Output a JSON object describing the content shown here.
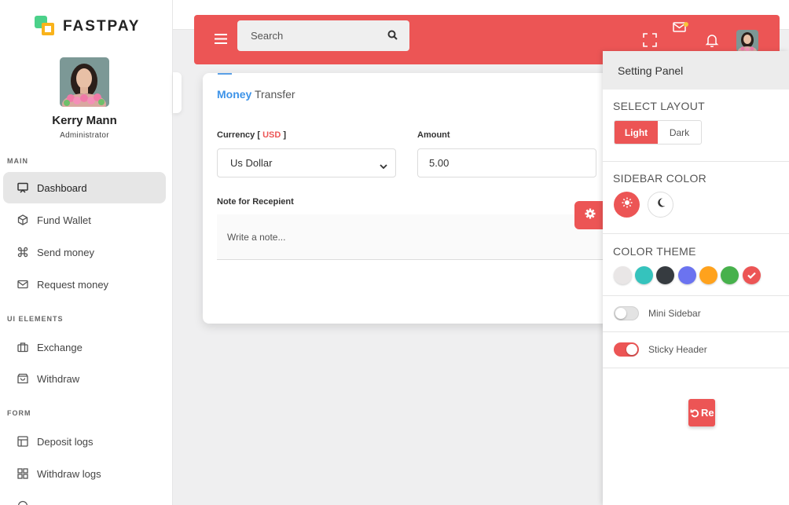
{
  "brand": {
    "name": "FASTPAY"
  },
  "user": {
    "name": "Kerry Mann",
    "role": "Administrator"
  },
  "sidebar": {
    "sections": [
      {
        "title": "MAIN",
        "items": [
          {
            "label": "Dashboard",
            "icon": "monitor-icon",
            "active": true
          },
          {
            "label": "Fund Wallet",
            "icon": "box-icon"
          },
          {
            "label": "Send money",
            "icon": "command-icon"
          },
          {
            "label": "Request money",
            "icon": "mail-icon"
          }
        ]
      },
      {
        "title": "UI ELEMENTS",
        "items": [
          {
            "label": "Exchange",
            "icon": "briefcase-icon"
          },
          {
            "label": "Withdraw",
            "icon": "shopping-bag-icon"
          }
        ]
      },
      {
        "title": "FORM",
        "items": [
          {
            "label": "Deposit logs",
            "icon": "layout-icon"
          },
          {
            "label": "Withdraw logs",
            "icon": "grid-icon"
          }
        ]
      }
    ]
  },
  "header": {
    "search_placeholder": "Search",
    "accent_color": "#ec5555"
  },
  "form": {
    "title_highlight": "Money",
    "title_rest": " Transfer",
    "currency_label": "Currency [",
    "currency_code": " USD ",
    "currency_label_end": "]",
    "currency_value": "Us Dollar",
    "amount_label": "Amount",
    "amount_value": "5.00",
    "note_label": "Note for Recepient",
    "note_placeholder": "Write a note..."
  },
  "settings": {
    "title": "Setting Panel",
    "layout_title": "SELECT LAYOUT",
    "layout_options": [
      "Light",
      "Dark"
    ],
    "layout_selected": "Light",
    "sidebar_color_title": "SIDEBAR COLOR",
    "color_theme_title": "COLOR THEME",
    "themes": [
      "#e9e6e6",
      "#35c3bd",
      "#363b40",
      "#6b73f0",
      "#ffa21d",
      "#47b14c",
      "#ec5555"
    ],
    "selected_theme": "#ec5555",
    "mini_sidebar_label": "Mini Sidebar",
    "mini_sidebar_on": false,
    "sticky_header_label": "Sticky Header",
    "sticky_header_on": true,
    "reset_label": "Re"
  }
}
